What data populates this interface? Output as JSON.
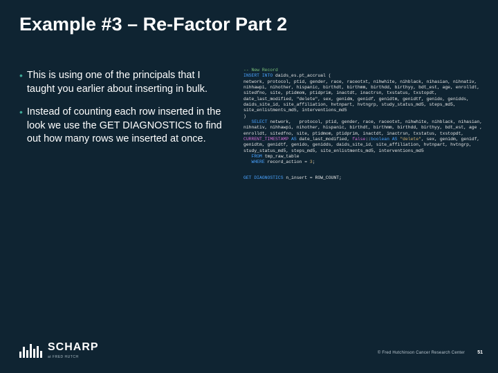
{
  "title": "Example #3 – Re-Factor Part 2",
  "bullets": [
    "This is using one of the principals that I taught you earlier about inserting in bulk.",
    "Instead of counting each row inserted in the look we use the GET DIAGNOSTICS to find out how many rows we inserted at once."
  ],
  "code": {
    "comment1": "-- New Record",
    "insert_kw": "INSERT INTO",
    "insert_target": " daids_es.pt_accrual (",
    "insert_cols": "network, protocol, ptid, gender, race, raceotxt, nihwhite, nihblack, nihasian, nihnativ, nihhawpi, nihother, hispanic, birthdt, birthmm, birthdd, birthyy, bdt_est, age, enrolldt, sitedfno, site, ptidmom, ptidprim, inactdt, inactrsn, txstatus, txstopdt, date_last_modified, \"delete\", sex, genidm, genidf, genidtm, genidtf, genido, genidds, daids_site_id, site_affiliation, hvtnpart, hvtngrp, study_status_md5, steps_md5, site_enlistments_md5, interventions_md5",
    "insert_close": ")",
    "select_kw": "SELECT",
    "select_cols": " network,   protocol, ptid, gender, race, raceotxt, nihwhite, nihblack, nihasian, nihnativ, nihhawpi, nihother, hispanic, birthdt, birthmm, birthdd, birthyy, bdt_est, age , enrolldt, sitedfno, site, ptidmom, ptidprim, inactdt, inactrsn, txstatus, txstopdt,",
    "current_ts_kw": "CURRENT_TIMESTAMP",
    "as_kw": " AS ",
    "dlm": "date_last_modified, ",
    "false_lit": "false",
    "cast": "::",
    "bool_type": "boolean",
    "as2": " AS ",
    "delete_col": "\"delete\"",
    "tail_cols": ", sex, genidm, genidf, genidtm, genidtf, genido, genidds, daids_site_id, site_affiliation, hvtnpart, hvtngrp, study_status_md5, steps_md5, site_enlistments_md5, interventions_md5",
    "from_kw": "FROM",
    "from_tbl": " tmp_raw_table",
    "where_kw": "WHERE",
    "where_expr": " record_action = ",
    "where_val": "3",
    "semi": ";",
    "diag_kw": "GET DIAGNOSTICS",
    "diag_body": " n_insert = ROW_COUNT",
    "diag_semi": ";"
  },
  "footer": {
    "logo_text": "SCHARP",
    "logo_sub": "at FRED HUTCH",
    "copyright": "© Fred Hutchinson Cancer Research Center",
    "page": "51"
  }
}
